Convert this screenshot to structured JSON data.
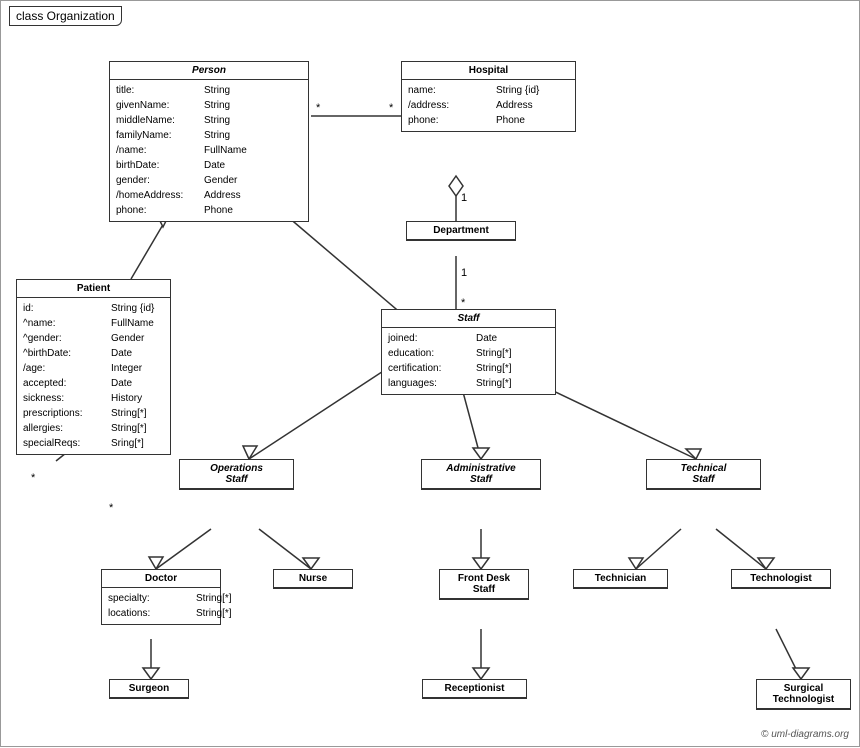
{
  "title": "class Organization",
  "classes": {
    "person": {
      "name": "Person",
      "italic": true,
      "attrs": [
        {
          "name": "title:",
          "type": "String"
        },
        {
          "name": "givenName:",
          "type": "String"
        },
        {
          "name": "middleName:",
          "type": "String"
        },
        {
          "name": "familyName:",
          "type": "String"
        },
        {
          "name": "/name:",
          "type": "FullName"
        },
        {
          "name": "birthDate:",
          "type": "Date"
        },
        {
          "name": "gender:",
          "type": "Gender"
        },
        {
          "name": "/homeAddress:",
          "type": "Address"
        },
        {
          "name": "phone:",
          "type": "Phone"
        }
      ]
    },
    "hospital": {
      "name": "Hospital",
      "italic": false,
      "attrs": [
        {
          "name": "name:",
          "type": "String {id}"
        },
        {
          "name": "/address:",
          "type": "Address"
        },
        {
          "name": "phone:",
          "type": "Phone"
        }
      ]
    },
    "department": {
      "name": "Department",
      "italic": false,
      "attrs": []
    },
    "staff": {
      "name": "Staff",
      "italic": true,
      "attrs": [
        {
          "name": "joined:",
          "type": "Date"
        },
        {
          "name": "education:",
          "type": "String[*]"
        },
        {
          "name": "certification:",
          "type": "String[*]"
        },
        {
          "name": "languages:",
          "type": "String[*]"
        }
      ]
    },
    "patient": {
      "name": "Patient",
      "italic": false,
      "attrs": [
        {
          "name": "id:",
          "type": "String {id}"
        },
        {
          "name": "^name:",
          "type": "FullName"
        },
        {
          "name": "^gender:",
          "type": "Gender"
        },
        {
          "name": "^birthDate:",
          "type": "Date"
        },
        {
          "name": "/age:",
          "type": "Integer"
        },
        {
          "name": "accepted:",
          "type": "Date"
        },
        {
          "name": "sickness:",
          "type": "History"
        },
        {
          "name": "prescriptions:",
          "type": "String[*]"
        },
        {
          "name": "allergies:",
          "type": "String[*]"
        },
        {
          "name": "specialReqs:",
          "type": "Sring[*]"
        }
      ]
    },
    "operations_staff": {
      "name": "Operations\nStaff",
      "italic": true,
      "attrs": []
    },
    "administrative_staff": {
      "name": "Administrative\nStaff",
      "italic": true,
      "attrs": []
    },
    "technical_staff": {
      "name": "Technical\nStaff",
      "italic": true,
      "attrs": []
    },
    "doctor": {
      "name": "Doctor",
      "italic": false,
      "attrs": [
        {
          "name": "specialty:",
          "type": "String[*]"
        },
        {
          "name": "locations:",
          "type": "String[*]"
        }
      ]
    },
    "nurse": {
      "name": "Nurse",
      "italic": false,
      "attrs": []
    },
    "front_desk_staff": {
      "name": "Front Desk\nStaff",
      "italic": false,
      "attrs": []
    },
    "technician": {
      "name": "Technician",
      "italic": false,
      "attrs": []
    },
    "technologist": {
      "name": "Technologist",
      "italic": false,
      "attrs": []
    },
    "surgeon": {
      "name": "Surgeon",
      "italic": false,
      "attrs": []
    },
    "receptionist": {
      "name": "Receptionist",
      "italic": false,
      "attrs": []
    },
    "surgical_technologist": {
      "name": "Surgical\nTechnologist",
      "italic": false,
      "attrs": []
    }
  },
  "copyright": "© uml-diagrams.org"
}
